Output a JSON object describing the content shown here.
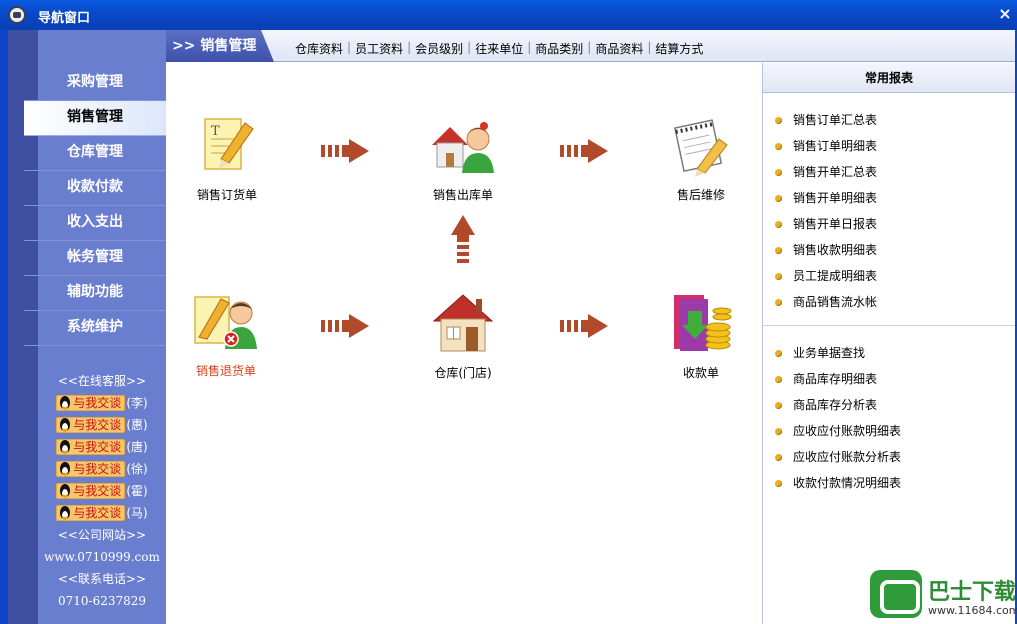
{
  "window": {
    "title": "导航窗口",
    "close_glyph": "×"
  },
  "sidebar": {
    "items": [
      {
        "label": "采购管理"
      },
      {
        "label": "销售管理"
      },
      {
        "label": "仓库管理"
      },
      {
        "label": "收款付款"
      },
      {
        "label": "收入支出"
      },
      {
        "label": "帐务管理"
      },
      {
        "label": "辅助功能"
      },
      {
        "label": "系统维护"
      }
    ],
    "active_index": 1,
    "service": {
      "heading": "<<在线客服>>",
      "chat_label": "与我交谈",
      "agents": [
        "(李)",
        "(惠)",
        "(唐)",
        "(徐)",
        "(霍)",
        "(马)"
      ],
      "site_heading": "<<公司网站>>",
      "site": "www.0710999.com",
      "phone_heading": "<<联系电话>>",
      "phone": "0710-6237829"
    }
  },
  "topbar": {
    "section_title": ">> 销售管理",
    "links": [
      "仓库资料",
      "员工资料",
      "会员级别",
      "往来单位",
      "商品类别",
      "商品资料",
      "结算方式"
    ]
  },
  "flow": {
    "nodes": {
      "sales_order": {
        "label": "销售订货单",
        "icon": "order-note-pencil-icon"
      },
      "sales_out": {
        "label": "销售出库单",
        "icon": "house-person-icon"
      },
      "after_sales": {
        "label": "售后维修",
        "icon": "notepad-pencil-icon"
      },
      "sales_return": {
        "label": "销售退货单",
        "icon": "return-note-user-icon"
      },
      "warehouse": {
        "label": "仓库(门店)",
        "icon": "house-icon"
      },
      "receipt": {
        "label": "收款单",
        "icon": "coins-folder-icon"
      }
    },
    "accent_red": "#d4431a"
  },
  "reports": {
    "title": "常用报表",
    "group1": [
      "销售订单汇总表",
      "销售订单明细表",
      "销售开单汇总表",
      "销售开单明细表",
      "销售开单日报表",
      "销售收款明细表",
      "员工提成明细表",
      "商品销售流水帐"
    ],
    "group2": [
      "业务单据查找",
      "商品库存明细表",
      "商品库存分析表",
      "应收应付账款明细表",
      "应收应付账款分析表",
      "收款付款情况明细表"
    ]
  },
  "watermark": {
    "brand": "巴士下载",
    "site": "www.11684.com"
  },
  "colors": {
    "titlebar": "#0848c8",
    "sidebar": "#6a7ed0",
    "sidebar_dark": "#3f4fa2",
    "arrow": "#b14a2a",
    "bullet": "#e5b020"
  }
}
